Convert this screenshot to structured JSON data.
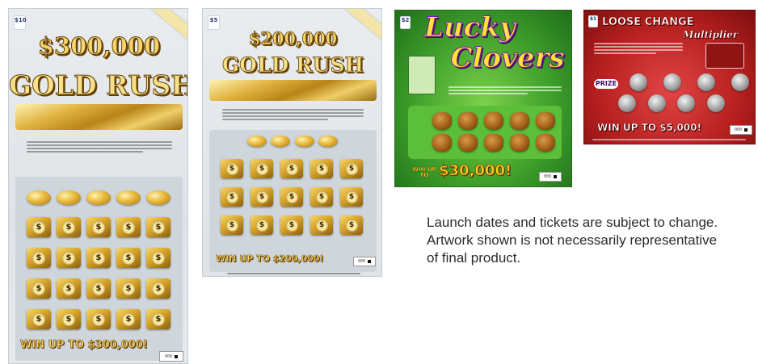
{
  "tickets": [
    {
      "game": "$300,000 GOLD RUSH",
      "headline_line1": "$300,000",
      "headline_line2": "GOLD RUSH",
      "price_badge": "$10",
      "prize_banner": "WIN UP TO $300,000!",
      "barcode_label": "000"
    },
    {
      "game": "$200,000 GOLD RUSH",
      "headline_line1": "$200,000",
      "headline_line2": "GOLD RUSH",
      "price_badge": "$5",
      "prize_banner": "WIN UP TO $200,000!",
      "barcode_label": "000"
    },
    {
      "game": "Lucky Clovers",
      "headline_line1": "Lucky",
      "headline_line2": "Clovers",
      "price_badge": "$2",
      "prize_prefix": "WIN UP TO",
      "prize_amount": "$30,000!",
      "barcode_label": "000"
    },
    {
      "game": "LOOSE CHANGE Multiplier",
      "headline_line1": "LOOSE CHANGE",
      "headline_line2": "Multiplier",
      "price_badge": "$1",
      "prize_label": "PRIZE",
      "prize_banner": "WIN UP TO $5,000!",
      "barcode_label": "000"
    }
  ],
  "disclaimer": {
    "line1": "Launch dates and tickets are subject to change.",
    "line2": "Artwork shown is not necessarily representative",
    "line3": "of final product."
  }
}
